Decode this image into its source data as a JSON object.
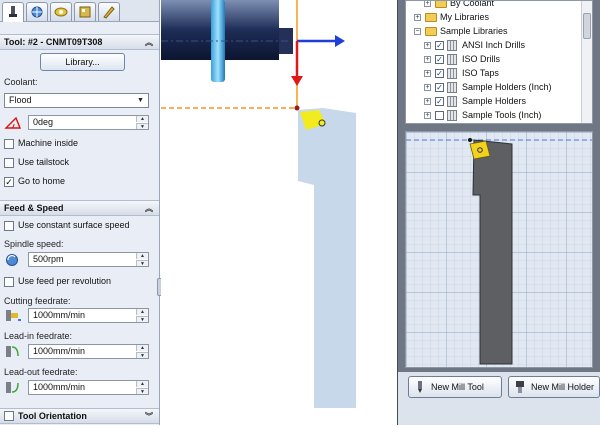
{
  "property_manager": {
    "tabs": [
      "tool-tab",
      "globe-tab",
      "feature-tab",
      "config-tab",
      "appearance-tab"
    ],
    "tool_section": {
      "title": "Tool: #2 - CNMT09T308",
      "library_button": "Library...",
      "coolant_label": "Coolant:",
      "coolant_value": "Flood",
      "angle_value": "0deg",
      "machine_inside": {
        "label": "Machine inside",
        "checked": false
      },
      "use_tailstock": {
        "label": "Use tailstock",
        "checked": false
      },
      "go_to_home": {
        "label": "Go to home",
        "checked": true
      }
    },
    "feed_section": {
      "title": "Feed & Speed",
      "constant_surface": {
        "label": "Use constant surface speed",
        "checked": false
      },
      "spindle_label": "Spindle speed:",
      "spindle_value": "500rpm",
      "feed_per_rev": {
        "label": "Use feed per revolution",
        "checked": false
      },
      "cutting_label": "Cutting feedrate:",
      "cutting_value": "1000mm/min",
      "leadin_label": "Lead-in feedrate:",
      "leadin_value": "1000mm/min",
      "leadout_label": "Lead-out feedrate:",
      "leadout_value": "1000mm/min"
    },
    "orientation_section": {
      "title": "Tool Orientation",
      "checked": false
    }
  },
  "library_window": {
    "tree": [
      {
        "label": "By Coolant",
        "type": "folder",
        "indent": 2,
        "expander": "+",
        "checked": null
      },
      {
        "label": "My Libraries",
        "type": "folder",
        "indent": 1,
        "expander": "+",
        "checked": null
      },
      {
        "label": "Sample Libraries",
        "type": "folder",
        "indent": 1,
        "expander": "-",
        "checked": null
      },
      {
        "label": "ANSI Inch Drills",
        "type": "library",
        "indent": 2,
        "expander": "+",
        "checked": true
      },
      {
        "label": "ISO Drills",
        "type": "library",
        "indent": 2,
        "expander": "+",
        "checked": true
      },
      {
        "label": "ISO Taps",
        "type": "library",
        "indent": 2,
        "expander": "+",
        "checked": true
      },
      {
        "label": "Sample Holders (Inch)",
        "type": "library",
        "indent": 2,
        "expander": "+",
        "checked": true
      },
      {
        "label": "Sample Holders",
        "type": "library",
        "indent": 2,
        "expander": "+",
        "checked": true
      },
      {
        "label": "Sample Tools (Inch)",
        "type": "library",
        "indent": 2,
        "expander": "+",
        "checked": false
      }
    ],
    "buttons": {
      "new_tool": "New Mill Tool",
      "new_holder": "New Mill Holder"
    }
  },
  "colors": {
    "axis_x": "#1f3fd8",
    "axis_y": "#e01818",
    "insert": "#f2ec1f",
    "holder_shadow": "#c6d8ea",
    "sketch_line": "#f39a1a",
    "preview_holder": "#5d5f63"
  }
}
